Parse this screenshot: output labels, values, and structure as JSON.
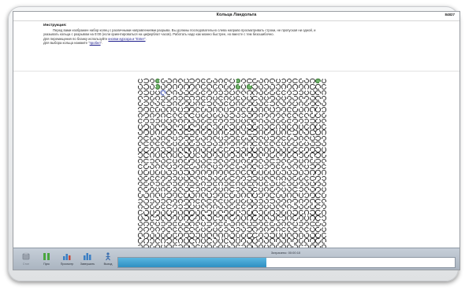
{
  "window": {
    "title": "Кольца Ландольта",
    "id_label": "84827"
  },
  "instructions": {
    "heading": "Инструкция:",
    "line1": "Перед вами изображен набор колец с различными направлениями разрыва. Вы должны последовательно слева направо просматривать строки, не пропуская ни одной, и",
    "line2": "указывать кольца с разрывом на 0:00 (если ориентироваться на циферблат часов). Работать надо как можно быстрее, но вместе с тем безошибочно.",
    "move_text": "Для перемещения по бланку используйте ",
    "move_link": "кнопки курсора и \"Enter\"",
    "move_end": ".",
    "select_text": "Для выбора кольца нажмите \"",
    "select_link": "пробел",
    "select_end": "\"."
  },
  "grid": {
    "rows": 30,
    "cols": 33,
    "marked_color": "#6fb46a",
    "ring_color": "#2c2c2c",
    "cursor_ring": [
      2,
      4
    ],
    "marked_rings": [
      [
        0,
        3
      ],
      [
        0,
        17
      ],
      [
        0,
        31
      ],
      [
        1,
        3
      ],
      [
        1,
        17
      ],
      [
        1,
        19
      ],
      [
        1,
        33
      ]
    ]
  },
  "toolbar": {
    "buttons": [
      {
        "label": "Стоп",
        "icon": "stop-icon",
        "enabled": false
      },
      {
        "label": "Пуск",
        "icon": "play-icon",
        "enabled": true
      },
      {
        "label": "Просмотр",
        "icon": "chart-icon",
        "enabled": true
      },
      {
        "label": "Завершить",
        "icon": "chart-end-icon",
        "enabled": true
      },
      {
        "label": "Выход",
        "icon": "exit-icon",
        "enabled": true
      }
    ],
    "progress_text": "Затрачено: 00:00:10",
    "progress_value": 0.44,
    "progress_color": "#2e8fc2"
  }
}
